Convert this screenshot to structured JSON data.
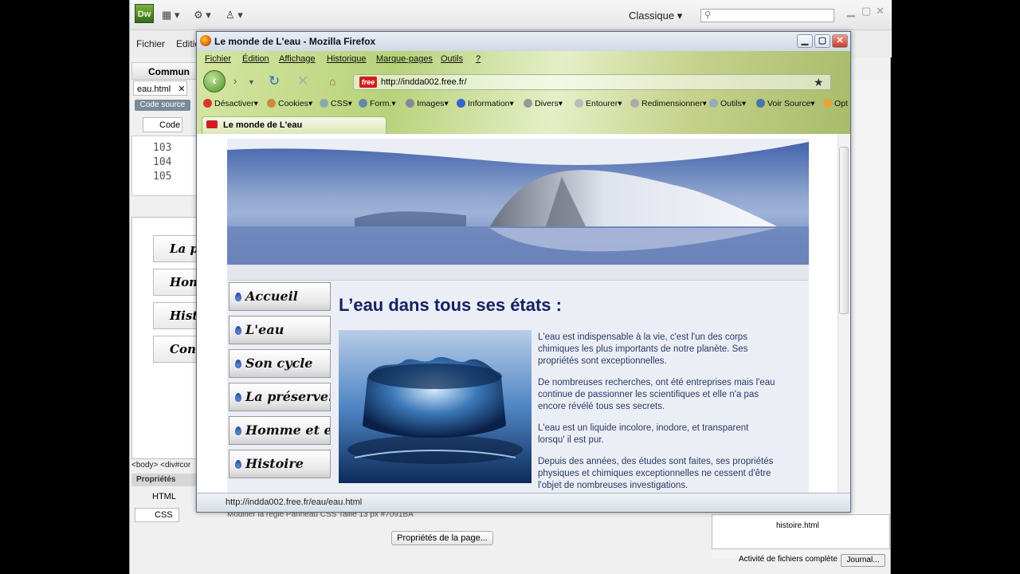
{
  "dreamweaver": {
    "logo": "Dw",
    "workspace": "Classique",
    "menu": [
      "Fichier",
      "Editio"
    ],
    "insert_category": "Commun",
    "document_tab": "eau.html",
    "code_source": "Code source",
    "code_view": "Code",
    "line_numbers": [
      "103",
      "104",
      "105"
    ],
    "design_nav": [
      "La p",
      "Hom",
      "Histo",
      "Cont"
    ],
    "tag_selector": "<body> <div#cor",
    "properties_title": "Propriétés",
    "html_button": "HTML",
    "css_button": "CSS",
    "page_properties_button": "Propriétés de la page...",
    "hidden_props": "Modifier la règle   Panneau CSS   Taille 13  px  #7091BA",
    "file_panel_item": "histoire.html",
    "status_text": "Activité de fichiers complète",
    "journal_button": "Journal..."
  },
  "firefox": {
    "title": "Le monde de L'eau - Mozilla Firefox",
    "menu": [
      "Fichier",
      "Édition",
      "Affichage",
      "Historique",
      "Marque-pages",
      "Outils",
      "?"
    ],
    "url": "http://indda002.free.fr/",
    "url_badge": "free",
    "webdev_toolbar": [
      "Désactiver",
      "Cookies",
      "CSS",
      "Form.",
      "Images",
      "Information",
      "Divers",
      "Entourer",
      "Redimensionner",
      "Outils",
      "Voir Source",
      "Opt"
    ],
    "tab_title": "Le monde de L'eau",
    "status_url": "http://indda002.free.fr/eau/eau.html"
  },
  "page": {
    "nav": [
      "Accueil",
      "L'eau",
      "Son cycle",
      "La préserver",
      "Homme et eau",
      "Histoire"
    ],
    "heading": "L’eau dans tous ses états :",
    "paragraphs": [
      "L'eau est indispensable à la vie, c'est l'un des corps chimiques les plus importants de notre planète. Ses propriétés sont exceptionnelles.",
      "De nombreuses recherches, ont été entreprises mais l'eau continue de passionner les scientifiques et elle n'a pas encore révélé tous ses secrets.",
      "L'eau est un liquide incolore, inodore, et transparent lorsqu' il est pur.",
      "Depuis des années, des études sont faites, ses propriétés physiques et chimiques exceptionnelles ne cessent d'être l'objet de nombreuses investigations."
    ],
    "colors": {
      "heading": "#152262",
      "body_text": "#2a3a66",
      "page_bg": "#eceef6"
    }
  }
}
